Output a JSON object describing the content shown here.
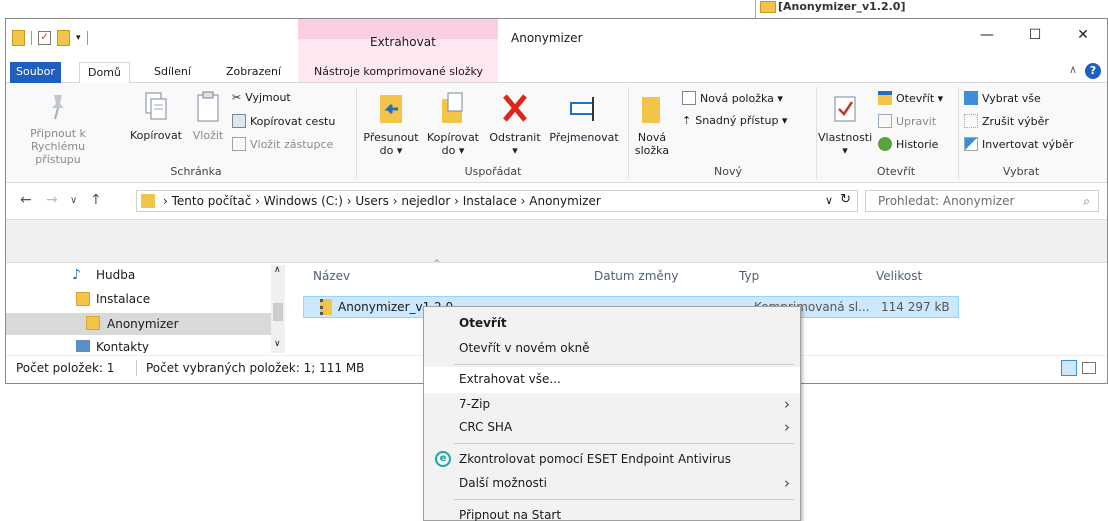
{
  "background_window": {
    "title": "[Anonymizer_v1.2.0]"
  },
  "titlebar": {
    "contextual_tab": "Extrahovat",
    "app_title": "Anonymizer",
    "minimize": "—",
    "maximize": "☐",
    "close": "✕"
  },
  "tabs": {
    "file": "Soubor",
    "home": "Domů",
    "share": "Sdílení",
    "view": "Zobrazení",
    "compressed": "Nástroje komprimované složky"
  },
  "ribbon": {
    "clipboard": {
      "label": "Schránka",
      "pin": [
        "Připnout k",
        "Rychlému přístupu"
      ],
      "copy": "Kopírovat",
      "paste": "Vložit",
      "cut": "Vyjmout",
      "copy_path": "Kopírovat cestu",
      "paste_shortcut": "Vložit zástupce"
    },
    "organize": {
      "label": "Uspořádat",
      "move_to": [
        "Přesunout",
        "do ▾"
      ],
      "copy_to": [
        "Kopírovat",
        "do ▾"
      ],
      "delete": "Odstranit",
      "delete_dd": "▾",
      "rename": "Přejmenovat"
    },
    "new": {
      "label": "Nový",
      "new_folder": [
        "Nová",
        "složka"
      ],
      "new_item": "Nová položka ▾",
      "easy_access": "Snadný přístup ▾"
    },
    "open": {
      "label": "Otevřít",
      "properties": "Vlastnosti",
      "properties_dd": "▾",
      "open": "Otevřít ▾",
      "edit": "Upravit",
      "history": "Historie"
    },
    "select": {
      "label": "Vybrat",
      "select_all": "Vybrat vše",
      "select_none": "Zrušit výběr",
      "invert": "Invertovat výběr"
    }
  },
  "address": {
    "path": "›  Tento počítač  ›  Windows (C:)  ›  Users  ›  nejedlor  ›  Instalace  ›  Anonymizer",
    "dropdown": "∨",
    "refresh": "↻",
    "search_placeholder": "Prohledat: Anonymizer"
  },
  "nav": {
    "items": [
      "Hudba",
      "Instalace",
      "Anonymizer",
      "Kontakty"
    ]
  },
  "columns": {
    "name": "Název",
    "date": "Datum změny",
    "type": "Typ",
    "size": "Velikost"
  },
  "file": {
    "name": "Anonymizer_v1.2.0",
    "type": "Komprimovaná sl...",
    "size": "114 297 kB"
  },
  "status": {
    "count": "Počet položek: 1",
    "selected": "Počet vybraných položek: 1; 111 MB"
  },
  "context_menu": {
    "open": "Otevřít",
    "open_new": "Otevřít v novém okně",
    "extract_all": "Extrahovat vše...",
    "seven_zip": "7-Zip",
    "crc": "CRC SHA",
    "eset": "Zkontrolovat pomocí ESET Endpoint Antivirus",
    "more": "Další možnosti",
    "pin_start": "Připnout na Start"
  }
}
